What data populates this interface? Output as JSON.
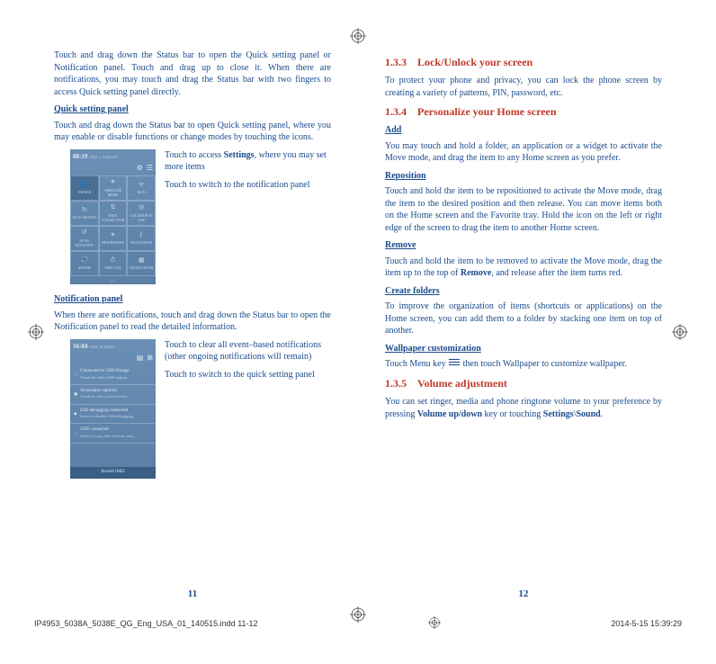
{
  "left": {
    "intro": "Touch and drag down the Status bar to open the Quick setting panel or Notification panel. Touch and drag up to close it. When there are notifications, you may touch and drag the Status bar with two fingers to access Quick setting panel directly.",
    "qsp_heading": "Quick setting panel",
    "qsp_body": "Touch and drag down the Status bar to open Quick setting panel, where you may enable or disable functions or change modes by touching the icons.",
    "qsp_callout1_pre": "Touch to access ",
    "qsp_callout1_bold": "Settings",
    "qsp_callout1_post": ", where you may set more items",
    "qsp_callout2": "Touch to switch to the notification panel",
    "notif_heading": "Notification panel",
    "notif_body": "When there are notifications, touch and drag down the Status bar to open the Notification panel to read the detailed information.",
    "notif_callout1": "Touch to clear all event–based notifications (other ongoing notifications will remain)",
    "notif_callout2": "Touch to switch to the quick setting panel",
    "page_num": "11",
    "mock1": {
      "time": "08:19",
      "date": "WED, 1 JANUARY",
      "tiles": [
        "OWNER",
        "AIRPLANE MODE",
        "Wi-Fi",
        "AUTO-ROTATE",
        "DATA CONNECTION",
        "LOCATION IN USE",
        "AUTO ROTATION",
        "BRIGHTNESS",
        "BLUETOOTH",
        "SOUND",
        "TIME OUT",
        "SAVING MODE"
      ]
    },
    "mock2": {
      "time": "16:04",
      "date": "WED, 29 WHEN",
      "n1_title": "Connected as USB Storage",
      "n1_sub": "Touch for other USB options",
      "n2_title": "Screenshot captured",
      "n2_sub": "Touch to view your screensh...",
      "n3_title": "USB debugging connected",
      "n3_sub": "Touch to disable USB debugging",
      "n4_title": "USB connected",
      "n4_sub": "Select to copy files to/from your...",
      "footer": "Invalid IMEI"
    }
  },
  "right": {
    "s133_num": "1.3.3",
    "s133_title": "Lock/Unlock your screen",
    "s133_body": "To protect your phone and privacy, you can lock the phone screen by creating a variety of patterns, PIN, password, etc.",
    "s134_num": "1.3.4",
    "s134_title": "Personalize your Home screen",
    "add_h": "Add",
    "add_body": "You may touch and hold a folder, an application or a widget to activate the Move mode, and drag the item to any Home screen as you prefer.",
    "repo_h": "Reposition",
    "repo_body": "Touch and hold the item to be repositioned to activate the Move mode, drag the item to the desired position and then release. You can move items both on the Home screen and the Favorite tray. Hold the icon on the left or right edge of the screen to drag the item to another Home screen.",
    "rem_h": "Remove",
    "rem_body_pre": "Touch and hold the item to be removed to activate the Move mode, drag the item up to the top of ",
    "rem_body_bold": "Remove",
    "rem_body_post": ", and release after the item turns red.",
    "fold_h": "Create folders",
    "fold_body": "To improve the organization of items (shortcuts or applications) on the Home screen, you can add them to a folder by stacking one item on top of another.",
    "wall_h": "Wallpaper customization",
    "wall_body_pre": "Touch Menu key ",
    "wall_body_post": " then touch Wallpaper to customize wallpaper.",
    "s135_num": "1.3.5",
    "s135_title": "Volume adjustment",
    "s135_body_pre": "You can set ringer, media and phone ringtone volume to your preference by pressing ",
    "s135_body_b1": "Volume up/down",
    "s135_body_mid": " key or touching ",
    "s135_body_b2": "Settings",
    "s135_body_sep": "\\",
    "s135_body_b3": "Sound",
    "s135_body_end": ".",
    "page_num": "12"
  },
  "footer": {
    "file": "IP4953_5038A_5038E_QG_Eng_USA_01_140515.indd   11-12",
    "timestamp": "2014-5-15   15:39:29"
  }
}
